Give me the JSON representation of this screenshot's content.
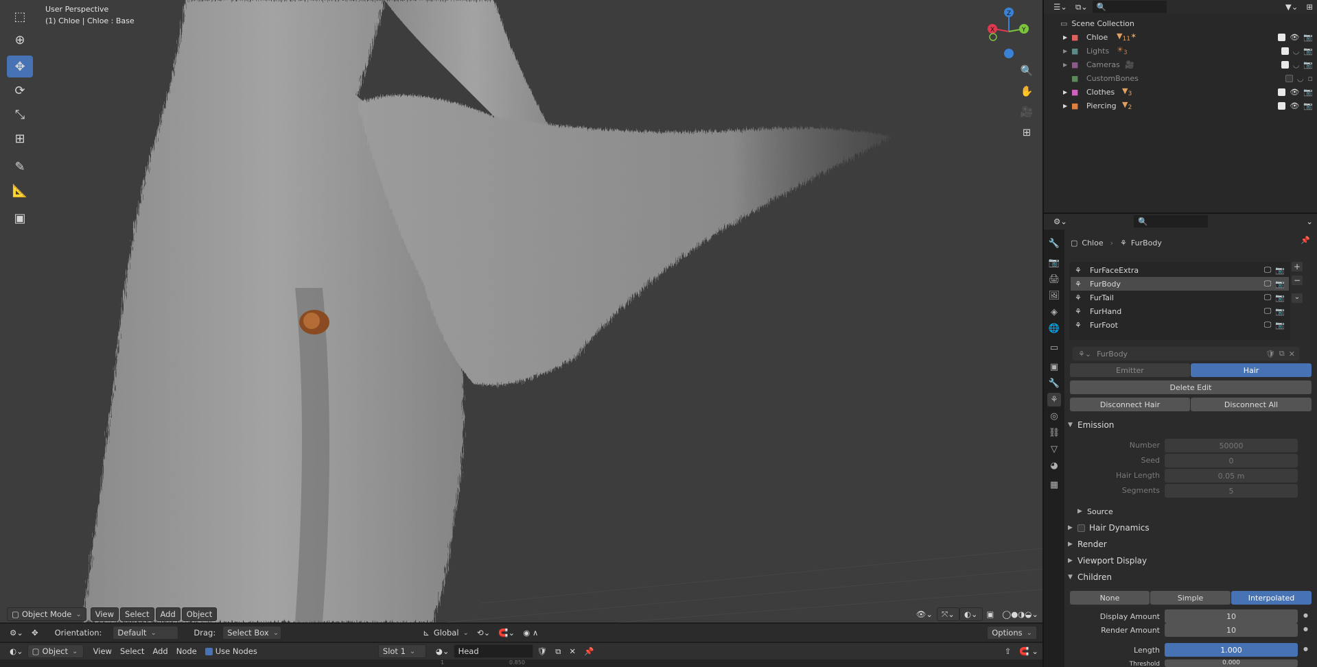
{
  "viewport": {
    "title": "User Perspective",
    "subtitle": "(1) Chloe | Chloe : Base",
    "header": {
      "mode": "Object Mode",
      "menus": [
        "View",
        "Select",
        "Add",
        "Object"
      ]
    },
    "tool_settings": {
      "orientation_label": "Orientation:",
      "orientation_value": "Default",
      "drag_label": "Drag:",
      "drag_value": "Select Box",
      "transform": "Global",
      "options": "Options"
    },
    "gizmo": {
      "x": "X",
      "y": "Y",
      "z": "Z"
    }
  },
  "node_header": {
    "editor": "Object",
    "menus": [
      "View",
      "Select",
      "Add",
      "Node"
    ],
    "use_nodes": "Use Nodes",
    "slot": "Slot 1",
    "material": "Head"
  },
  "timeline_ticks": [
    "1",
    "0.850"
  ],
  "outliner": {
    "root": "Scene Collection",
    "items": [
      {
        "name": "Chloe",
        "badge": "11",
        "dim": false,
        "checked": true
      },
      {
        "name": "Lights",
        "badge": "3",
        "dim": true,
        "checked": true
      },
      {
        "name": "Cameras",
        "badge": "",
        "dim": true,
        "checked": true
      },
      {
        "name": "CustomBones",
        "badge": "",
        "dim": true,
        "checked": false
      },
      {
        "name": "Clothes",
        "badge": "3",
        "dim": false,
        "checked": true
      },
      {
        "name": "Piercing",
        "badge": "2",
        "dim": false,
        "checked": true
      }
    ]
  },
  "properties": {
    "breadcrumb": {
      "object": "Chloe",
      "system": "FurBody"
    },
    "systems": [
      "FurFaceExtra",
      "FurBody",
      "FurTail",
      "FurHand",
      "FurFoot"
    ],
    "selected_system": "FurBody",
    "settings_name": "FurBody",
    "type_tabs": {
      "emitter": "Emitter",
      "hair": "Hair"
    },
    "buttons": {
      "delete_edit": "Delete Edit",
      "disconnect_hair": "Disconnect Hair",
      "disconnect_all": "Disconnect All"
    },
    "emission": {
      "title": "Emission",
      "number_label": "Number",
      "number": "50000",
      "seed_label": "Seed",
      "seed": "0",
      "hair_length_label": "Hair Length",
      "hair_length": "0.05 m",
      "segments_label": "Segments",
      "segments": "5",
      "source": "Source"
    },
    "panels": {
      "hair_dynamics": "Hair Dynamics",
      "render": "Render",
      "viewport_display": "Viewport Display",
      "children": "Children"
    },
    "children": {
      "modes": [
        "None",
        "Simple",
        "Interpolated"
      ],
      "active_mode": "Interpolated",
      "display_amount_label": "Display Amount",
      "display_amount": "10",
      "render_amount_label": "Render Amount",
      "render_amount": "10",
      "length_label": "Length",
      "length": "1.000",
      "threshold_label": "Threshold",
      "threshold": "0.000"
    }
  },
  "colors": {
    "accent": "#4772b3",
    "viewport_bg": "#3d3d3d",
    "panel_bg": "#2b2b2b",
    "fur": "#9a9a9a",
    "gizmo_x": "#e0394f",
    "gizmo_y": "#7cc43b",
    "gizmo_z": "#3a82d6"
  }
}
